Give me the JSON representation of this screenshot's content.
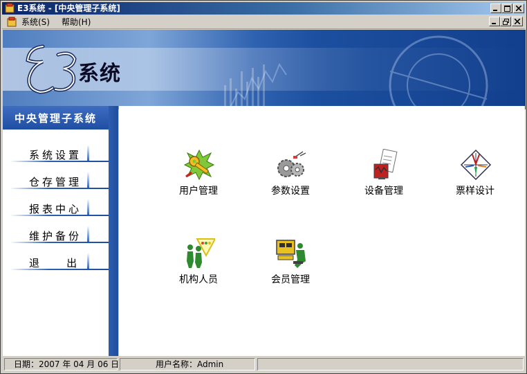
{
  "window": {
    "title": "E3系统 - [中央管理子系统]",
    "buttons": {
      "minimize": "minimize",
      "maximize": "maximize",
      "close": "close"
    }
  },
  "menubar": {
    "items": [
      {
        "label": "系统(S)",
        "accelerator": "S"
      },
      {
        "label": "帮助(H)",
        "accelerator": "H"
      }
    ],
    "mdi_buttons": {
      "minimize": "minimize",
      "restore": "restore",
      "close": "close"
    }
  },
  "banner": {
    "logo": "E3",
    "title": "系统"
  },
  "sidebar": {
    "header": "中央管理子系统",
    "items": [
      {
        "label": "系统设置"
      },
      {
        "label": "仓存管理"
      },
      {
        "label": "报表中心"
      },
      {
        "label": "维护备份"
      },
      {
        "label": "退    出"
      }
    ]
  },
  "modules": [
    {
      "label": "用户管理",
      "icon": "key-icon"
    },
    {
      "label": "参数设置",
      "icon": "gears-icon"
    },
    {
      "label": "设备管理",
      "icon": "device-doc-icon"
    },
    {
      "label": "票样设计",
      "icon": "compass-design-icon"
    },
    {
      "label": "机构人员",
      "icon": "people-chart-icon"
    },
    {
      "label": "会员管理",
      "icon": "member-desk-icon"
    }
  ],
  "statusbar": {
    "date": "日期：2007 年 04 月 06 日",
    "user": "用户名称：Admin",
    "extra": ""
  },
  "colors": {
    "title_gradient_start": "#0a246a",
    "title_gradient_end": "#a6caf0",
    "sidebar_blue": "#1f4fa3",
    "window_face": "#d4d0c8"
  }
}
